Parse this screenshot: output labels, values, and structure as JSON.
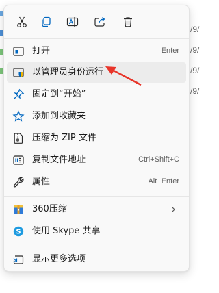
{
  "background": {
    "fragments": [
      "/9/",
      "/9/",
      "/9/",
      "/9/"
    ]
  },
  "toolbar": {
    "buttons": [
      {
        "icon": "cut-icon",
        "name": "cut"
      },
      {
        "icon": "copy-icon",
        "name": "copy"
      },
      {
        "icon": "rename-icon",
        "name": "rename"
      },
      {
        "icon": "share-icon",
        "name": "share"
      },
      {
        "icon": "delete-icon",
        "name": "delete"
      }
    ]
  },
  "menu": {
    "items": [
      {
        "label": "打开",
        "shortcut": "Enter",
        "icon": "open-icon"
      },
      {
        "label": "以管理员身份运行",
        "shortcut": "",
        "icon": "shield-run-as-admin-icon",
        "highlighted": true
      },
      {
        "label": "固定到“开始”",
        "shortcut": "",
        "icon": "pin-icon"
      },
      {
        "label": "添加到收藏夹",
        "shortcut": "",
        "icon": "star-icon"
      },
      {
        "label": "压缩为 ZIP 文件",
        "shortcut": "",
        "icon": "zip-icon"
      },
      {
        "label": "复制文件地址",
        "shortcut": "Ctrl+Shift+C",
        "icon": "copy-path-icon"
      },
      {
        "label": "属性",
        "shortcut": "Alt+Enter",
        "icon": "wrench-icon"
      },
      {
        "label": "360压缩",
        "shortcut": "",
        "icon": "360-compress-icon",
        "has_submenu": true
      },
      {
        "label": "使用 Skype 共享",
        "shortcut": "",
        "icon": "skype-icon"
      },
      {
        "label": "显示更多选项",
        "shortcut": "",
        "icon": "more-options-icon"
      }
    ]
  },
  "colors": {
    "accent": "#0067c0",
    "annotation_arrow": "#e8352a",
    "highlight": "#ececec"
  }
}
